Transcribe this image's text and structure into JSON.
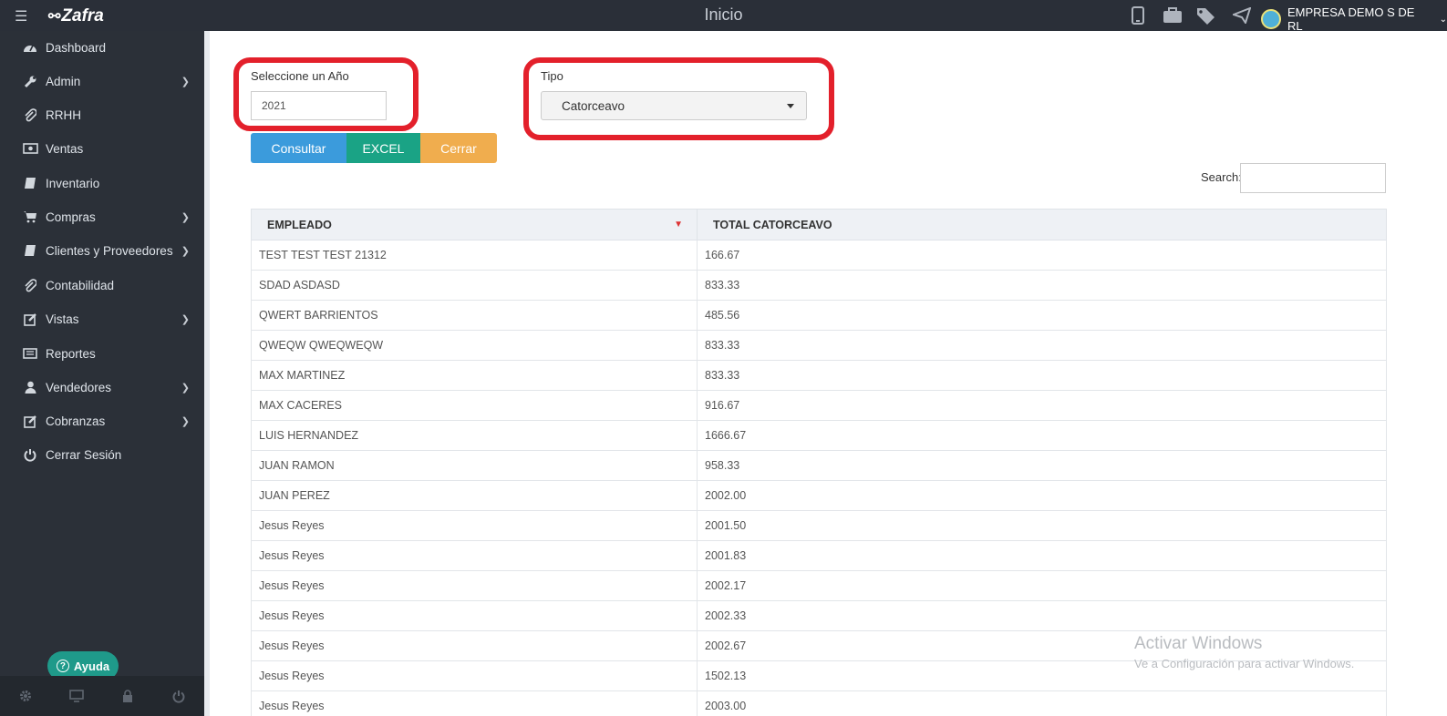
{
  "header": {
    "brand": "Zafra",
    "title": "Inicio",
    "company": "EMPRESA DEMO S DE RL",
    "icons": [
      "mobile-icon",
      "briefcase-icon",
      "tags-icon",
      "send-icon"
    ]
  },
  "sidebar": {
    "items": [
      {
        "label": "Dashboard",
        "icon": "dashboard-icon",
        "submenu": false
      },
      {
        "label": "Admin",
        "icon": "wrench-icon",
        "submenu": true
      },
      {
        "label": "RRHH",
        "icon": "paperclip-icon",
        "submenu": false
      },
      {
        "label": "Ventas",
        "icon": "money-icon",
        "submenu": false
      },
      {
        "label": "Inventario",
        "icon": "book-icon",
        "submenu": false
      },
      {
        "label": "Compras",
        "icon": "cart-icon",
        "submenu": true
      },
      {
        "label": "Clientes y Proveedores",
        "icon": "book-icon",
        "submenu": true
      },
      {
        "label": "Contabilidad",
        "icon": "paperclip-icon",
        "submenu": false
      },
      {
        "label": "Vistas",
        "icon": "edit-icon",
        "submenu": true
      },
      {
        "label": "Reportes",
        "icon": "list-icon",
        "submenu": false
      },
      {
        "label": "Vendedores",
        "icon": "user-icon",
        "submenu": true
      },
      {
        "label": "Cobranzas",
        "icon": "edit-icon",
        "submenu": true
      },
      {
        "label": "Cerrar Sesión",
        "icon": "power-icon",
        "submenu": false
      }
    ],
    "help_label": "Ayuda",
    "footer_icons": [
      "gear-icon",
      "monitor-icon",
      "lock-icon",
      "power-icon"
    ]
  },
  "form": {
    "year_label": "Seleccione un Año",
    "year_value": "2021",
    "type_label": "Tipo",
    "type_value": "Catorceavo",
    "highlight_color": "#e3202b"
  },
  "buttons": {
    "consultar": "Consultar",
    "excel": "EXCEL",
    "cerrar": "Cerrar",
    "colors": {
      "consultar": "#3b9bdc",
      "excel": "#1aa385",
      "cerrar": "#f0ad4e"
    }
  },
  "search": {
    "label": "Search:",
    "value": ""
  },
  "table": {
    "headers": [
      "EMPLEADO",
      "TOTAL CATORCEAVO"
    ],
    "rows": [
      [
        "TEST TEST TEST 21312",
        "166.67"
      ],
      [
        "SDAD ASDASD",
        "833.33"
      ],
      [
        "QWERT BARRIENTOS",
        "485.56"
      ],
      [
        "QWEQW QWEQWEQW",
        "833.33"
      ],
      [
        "MAX MARTINEZ",
        "833.33"
      ],
      [
        "MAX CACERES",
        "916.67"
      ],
      [
        "LUIS HERNANDEZ",
        "1666.67"
      ],
      [
        "JUAN RAMON",
        "958.33"
      ],
      [
        "JUAN PEREZ",
        "2002.00"
      ],
      [
        "Jesus Reyes",
        "2001.50"
      ],
      [
        "Jesus Reyes",
        "2001.83"
      ],
      [
        "Jesus Reyes",
        "2002.17"
      ],
      [
        "Jesus Reyes",
        "2002.33"
      ],
      [
        "Jesus Reyes",
        "2002.67"
      ],
      [
        "Jesus Reyes",
        "1502.13"
      ],
      [
        "Jesus Reyes",
        "2003.00"
      ]
    ]
  },
  "watermark": {
    "line1": "Activar Windows",
    "line2": "Ve a Configuración para activar Windows."
  }
}
